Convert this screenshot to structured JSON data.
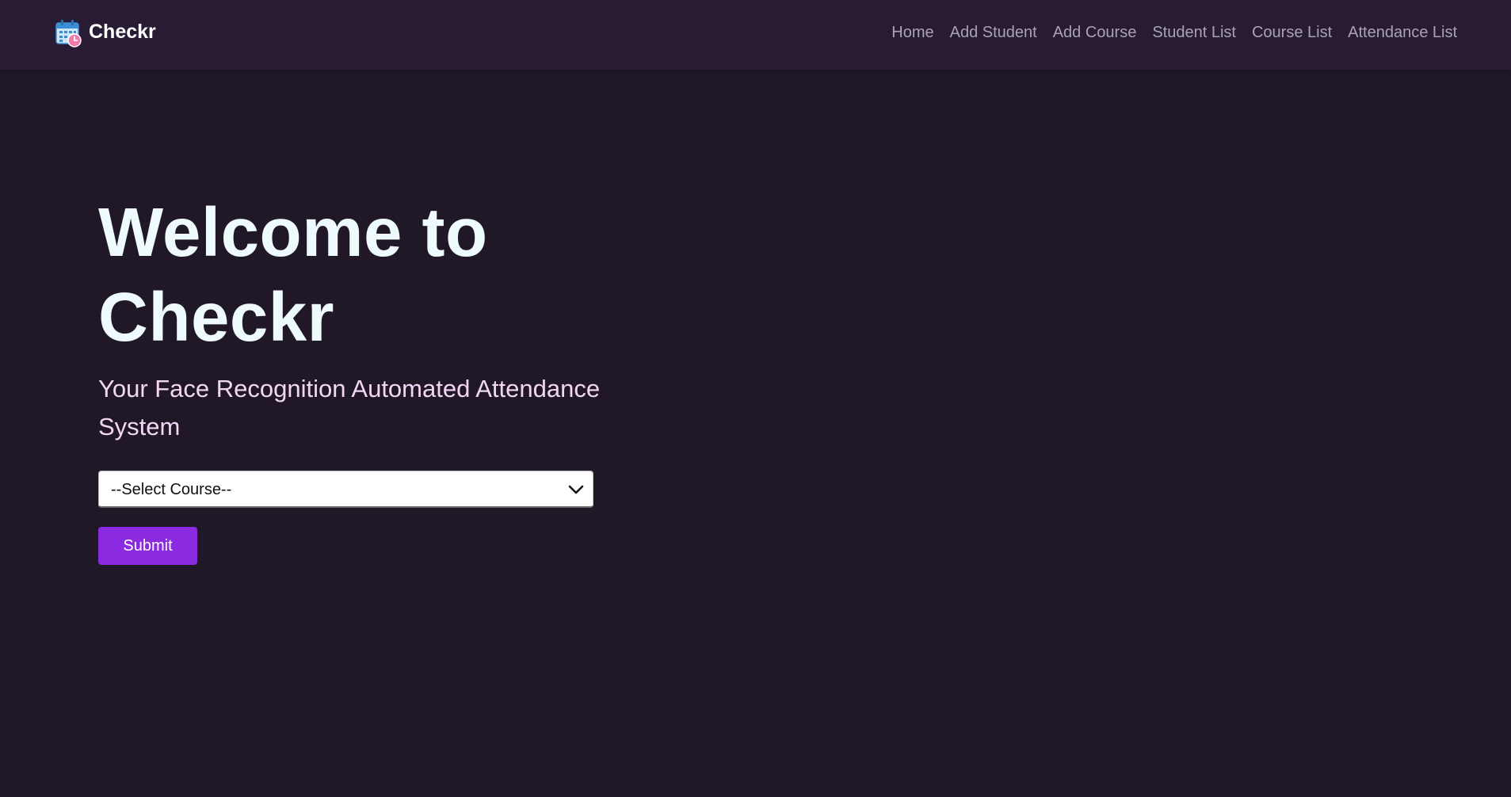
{
  "navbar": {
    "brand": {
      "icon": "calendar-clock-icon",
      "label": "Checkr"
    },
    "links": [
      {
        "label": "Home"
      },
      {
        "label": "Add Student"
      },
      {
        "label": "Add Course"
      },
      {
        "label": "Student List"
      },
      {
        "label": "Course List"
      },
      {
        "label": "Attendance List"
      }
    ]
  },
  "hero": {
    "title_line1": "Welcome to",
    "title_line2": "Checkr",
    "subtitle": "Your Face Recognition Automated Attendance System"
  },
  "form": {
    "course_select": {
      "selected": "--Select Course--",
      "icon": "chevron-down-icon"
    },
    "submit_label": "Submit"
  },
  "colors": {
    "background": "#201827",
    "navbar": "#281c35",
    "accent": "#8a2be2",
    "title": "#eefafc",
    "subtitle": "#f2d7f5",
    "nav_link": "#a9a3b3"
  }
}
